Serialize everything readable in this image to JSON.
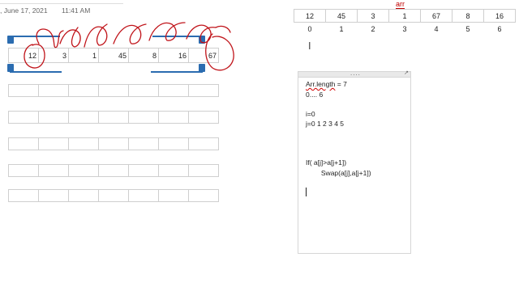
{
  "header": {
    "date": ", June 17, 2021",
    "time": "11:41 AM"
  },
  "left_table": {
    "row_values": [
      "12",
      "3",
      "1",
      "45",
      "8",
      "16",
      "67"
    ]
  },
  "arr_table": {
    "title": "arr",
    "values": [
      "12",
      "45",
      "3",
      "1",
      "67",
      "8",
      "16"
    ],
    "indices": [
      "0",
      "1",
      "2",
      "3",
      "4",
      "5",
      "6"
    ]
  },
  "note": {
    "grip": "....",
    "expand": "↗",
    "lines": {
      "line1_underlined": "Arr.length",
      "line1_rest": " = 7",
      "line2": "0.... 6",
      "line3": "i=0",
      "line4": "j=0 1 2 3 4 5",
      "line5": "If( a[j]>a[j+1])",
      "line6": "        Swap(a[j],a[j+1])"
    }
  },
  "colors": {
    "ink": "#c0141a",
    "selection": "#2b6cb0",
    "arr_title": "#c00000"
  },
  "icons": {
    "cursor": "text-cursor-ibeam-icon"
  }
}
